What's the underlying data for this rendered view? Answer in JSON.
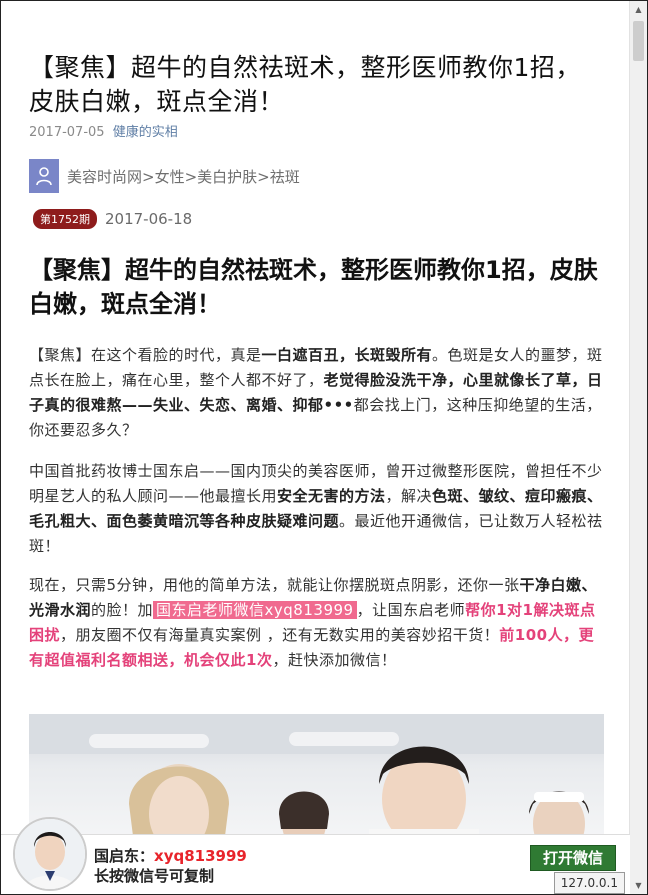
{
  "article": {
    "title": "【聚焦】超牛的自然祛斑术，整形医师教你1招，皮肤白嫩，斑点全消！",
    "date": "2017-07-05",
    "account": "健康的实相"
  },
  "breadcrumb": "美容时尚网>女性>美白护肤>祛斑",
  "issue": {
    "badge": "第1752期",
    "date": "2017-06-18"
  },
  "headline": "【聚焦】超牛的自然祛斑术，整形医师教你1招，皮肤白嫩，斑点全消！",
  "p1": {
    "s1": "【聚焦】在这个看脸的时代，真是",
    "b1": "一白遮百丑，长斑毁所有",
    "s2": "。色斑是女人的噩梦，斑点长在脸上，痛在心里，整个人都不好了，",
    "b2": "老觉得脸没洗干净，心里就像长了草，日子真的很难熬——失业、失恋、离婚、抑郁•••",
    "s3": "都会找上门，这种压抑绝望的生活，你还要忍多久？"
  },
  "p2": {
    "s1": "中国首批药妆博士国东启——国内顶尖的美容医师，曾开过微整形医院，曾担任不少明星艺人的私人顾问——他最擅长用",
    "b1": "安全无害的方法",
    "s2": "，解决",
    "b2": "色斑、皱纹、痘印瘢痕、毛孔粗大、面色萎黄暗沉等各种皮肤疑难问题",
    "s3": "。最近他开通微信，已让数万人轻松祛斑！"
  },
  "p3": {
    "s1": "现在，只需5分钟，用他的简单方法，就能让你摆脱斑点阴影，还你一张",
    "b1": "干净白嫩、光滑水润",
    "s2": "的脸！加",
    "hl": "国东启老师微信xyq813999",
    "s3": "，让国东启老师",
    "pk1": "帮你1对1解决斑点困扰",
    "s4": "，朋友圈不仅有海量真实案例 ，还有无数实用的美容妙招干货！",
    "pk2": "前100人，更有超值福利名额相送，机会仅此1次",
    "s5": "，赶快添加微信！"
  },
  "bottom_bar": {
    "name": "国启东：",
    "wechat": "xyq813999",
    "hint": "长按微信号可复制",
    "open_button": "打开微信"
  },
  "status_url": "127.0.0.1",
  "colors": {
    "badge": "#8e1c1c",
    "highlight_bg": "#f06a8f",
    "pink_text": "#e4427a",
    "wechat_red": "#e8242b",
    "open_button": "#2f7a33"
  }
}
